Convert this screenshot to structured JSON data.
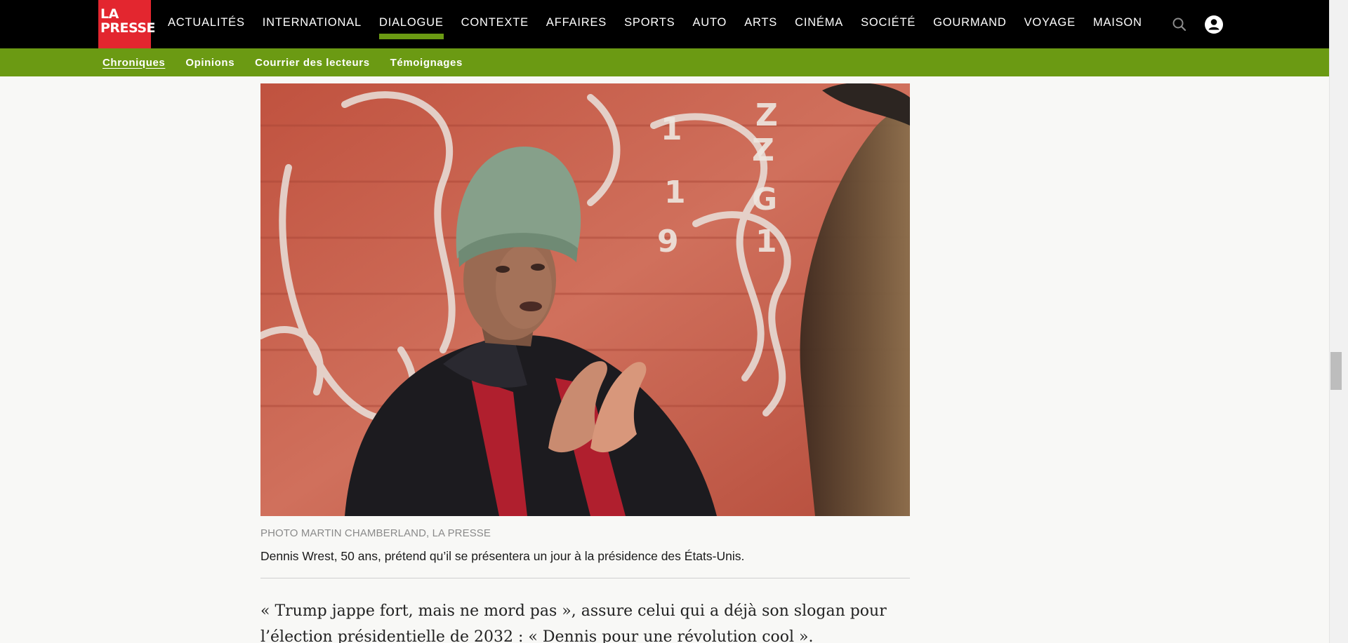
{
  "brand": {
    "logo_line1": "LA",
    "logo_line2": "PRESSE",
    "logo_color": "#e3262f"
  },
  "main_nav": [
    {
      "label": "ACTUALITÉS",
      "active": false
    },
    {
      "label": "INTERNATIONAL",
      "active": false
    },
    {
      "label": "DIALOGUE",
      "active": true
    },
    {
      "label": "CONTEXTE",
      "active": false
    },
    {
      "label": "AFFAIRES",
      "active": false
    },
    {
      "label": "SPORTS",
      "active": false
    },
    {
      "label": "AUTO",
      "active": false
    },
    {
      "label": "ARTS",
      "active": false
    },
    {
      "label": "CINÉMA",
      "active": false
    },
    {
      "label": "SOCIÉTÉ",
      "active": false
    },
    {
      "label": "GOURMAND",
      "active": false
    },
    {
      "label": "VOYAGE",
      "active": false
    },
    {
      "label": "MAISON",
      "active": false
    }
  ],
  "header_icons": {
    "search": "search-icon",
    "account": "account-icon"
  },
  "sub_nav": [
    {
      "label": "Chroniques",
      "active": true
    },
    {
      "label": "Opinions",
      "active": false
    },
    {
      "label": "Courrier des lecteurs",
      "active": false
    },
    {
      "label": "Témoignages",
      "active": false
    }
  ],
  "accent_color": "#6b9a13",
  "article": {
    "photo_credit": "PHOTO MARTIN CHAMBERLAND, LA PRESSE",
    "photo_caption": "Dennis Wrest, 50 ans, prétend qu’il se présentera un jour à la présidence des États-Unis.",
    "paragraph": "« Trump jappe fort, mais ne mord pas », assure celui qui a déjà son slogan pour l’élection présidentielle de 2032 : « Dennis pour une révolution cool »."
  }
}
